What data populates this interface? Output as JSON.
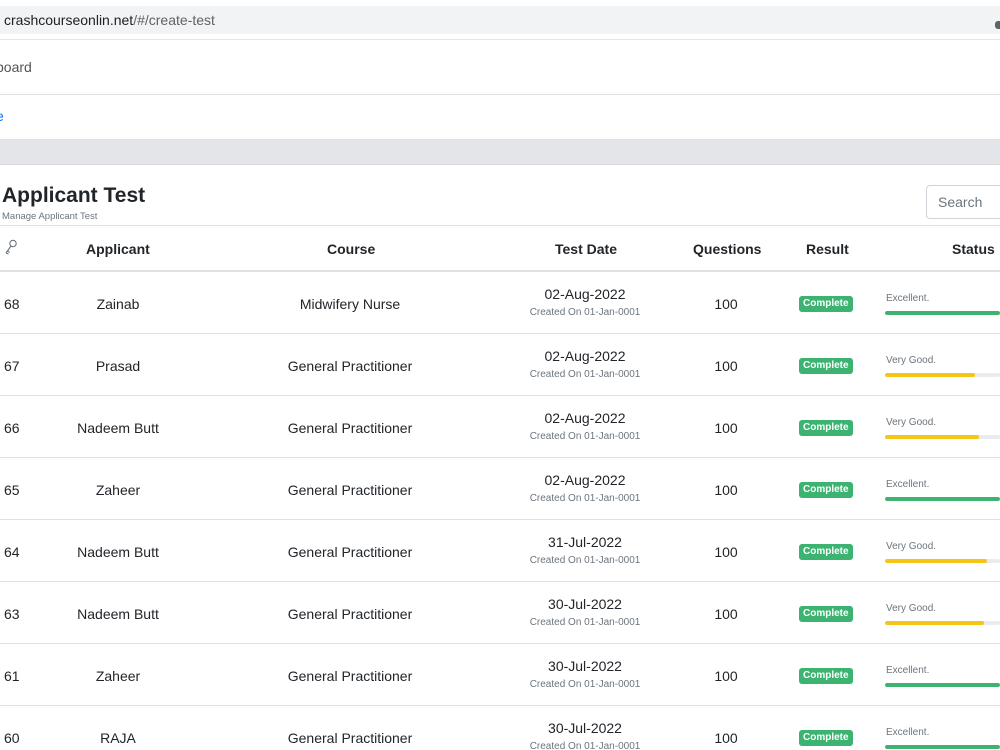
{
  "browser": {
    "url_host": "crashcourseonlin.net",
    "url_path": "/#/create-test"
  },
  "nav": {
    "dashboard_label": "board",
    "home_label": "e"
  },
  "card": {
    "title": "Applicant Test",
    "subtitle": "Manage Applicant Test",
    "search_placeholder": "Search"
  },
  "icons": {
    "key": "key-icon"
  },
  "colors": {
    "excellent": "#3cb371",
    "very_good": "#f5c518",
    "complete_badge": "#3cb371",
    "link": "#0d6efd"
  },
  "table": {
    "headers": {
      "applicant": "Applicant",
      "course": "Course",
      "test_date": "Test Date",
      "questions": "Questions",
      "result": "Result",
      "status": "Status"
    },
    "rows": [
      {
        "id": "68",
        "applicant": "Zainab",
        "course": "Midwifery Nurse",
        "date": "02-Aug-2022",
        "created": "Created On 01-Jan-0001",
        "questions": "100",
        "result": "Complete",
        "status": "Excellent.",
        "score": 100
      },
      {
        "id": "67",
        "applicant": "Prasad",
        "course": "General Practitioner",
        "date": "02-Aug-2022",
        "created": "Created On 01-Jan-0001",
        "questions": "100",
        "result": "Complete",
        "status": "Very Good.",
        "score": 78
      },
      {
        "id": "66",
        "applicant": "Nadeem Butt",
        "course": "General Practitioner",
        "date": "02-Aug-2022",
        "created": "Created On 01-Jan-0001",
        "questions": "100",
        "result": "Complete",
        "status": "Very Good.",
        "score": 82
      },
      {
        "id": "65",
        "applicant": "Zaheer",
        "course": "General Practitioner",
        "date": "02-Aug-2022",
        "created": "Created On 01-Jan-0001",
        "questions": "100",
        "result": "Complete",
        "status": "Excellent.",
        "score": 100
      },
      {
        "id": "64",
        "applicant": "Nadeem Butt",
        "course": "General Practitioner",
        "date": "31-Jul-2022",
        "created": "Created On 01-Jan-0001",
        "questions": "100",
        "result": "Complete",
        "status": "Very Good.",
        "score": 89
      },
      {
        "id": "63",
        "applicant": "Nadeem Butt",
        "course": "General Practitioner",
        "date": "30-Jul-2022",
        "created": "Created On 01-Jan-0001",
        "questions": "100",
        "result": "Complete",
        "status": "Very Good.",
        "score": 86
      },
      {
        "id": "61",
        "applicant": "Zaheer",
        "course": "General Practitioner",
        "date": "30-Jul-2022",
        "created": "Created On 01-Jan-0001",
        "questions": "100",
        "result": "Complete",
        "status": "Excellent.",
        "score": 100
      },
      {
        "id": "60",
        "applicant": "RAJA",
        "course": "General Practitioner",
        "date": "30-Jul-2022",
        "created": "Created On 01-Jan-0001",
        "questions": "100",
        "result": "Complete",
        "status": "Excellent.",
        "score": 100
      }
    ]
  }
}
